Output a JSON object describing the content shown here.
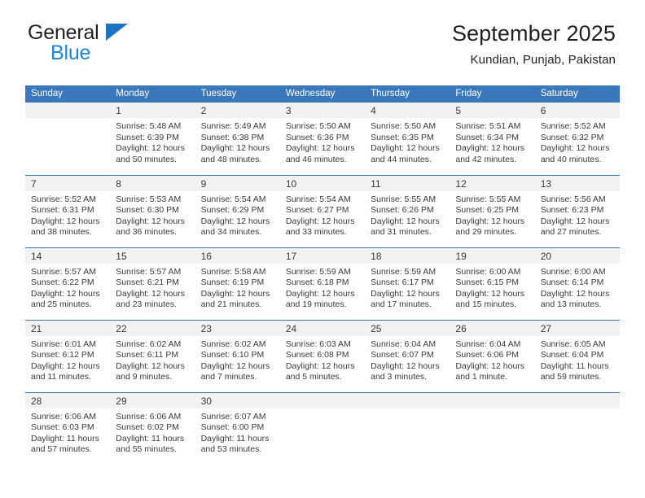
{
  "brand": {
    "line1": "General",
    "line2": "Blue",
    "triangle_color": "#1f72bd",
    "line2_color": "#1f84d6"
  },
  "header": {
    "title": "September 2025",
    "subtitle": "Kundian, Punjab, Pakistan"
  },
  "theme": {
    "header_bar": "#3b77bb",
    "daynum_band": "#f2f2f2",
    "text": "#3a3a3a"
  },
  "labels": {
    "sunrise_prefix": "Sunrise:",
    "sunset_prefix": "Sunset:",
    "daylight_prefix": "Daylight:"
  },
  "weekday_headers": [
    "Sunday",
    "Monday",
    "Tuesday",
    "Wednesday",
    "Thursday",
    "Friday",
    "Saturday"
  ],
  "weeks": [
    [
      {
        "day": "",
        "blank": true
      },
      {
        "day": "1",
        "sunrise": "Sunrise: 5:48 AM",
        "sunset": "Sunset: 6:39 PM",
        "daylight1": "Daylight: 12 hours",
        "daylight2": "and 50 minutes."
      },
      {
        "day": "2",
        "sunrise": "Sunrise: 5:49 AM",
        "sunset": "Sunset: 6:38 PM",
        "daylight1": "Daylight: 12 hours",
        "daylight2": "and 48 minutes."
      },
      {
        "day": "3",
        "sunrise": "Sunrise: 5:50 AM",
        "sunset": "Sunset: 6:36 PM",
        "daylight1": "Daylight: 12 hours",
        "daylight2": "and 46 minutes."
      },
      {
        "day": "4",
        "sunrise": "Sunrise: 5:50 AM",
        "sunset": "Sunset: 6:35 PM",
        "daylight1": "Daylight: 12 hours",
        "daylight2": "and 44 minutes."
      },
      {
        "day": "5",
        "sunrise": "Sunrise: 5:51 AM",
        "sunset": "Sunset: 6:34 PM",
        "daylight1": "Daylight: 12 hours",
        "daylight2": "and 42 minutes."
      },
      {
        "day": "6",
        "sunrise": "Sunrise: 5:52 AM",
        "sunset": "Sunset: 6:32 PM",
        "daylight1": "Daylight: 12 hours",
        "daylight2": "and 40 minutes."
      }
    ],
    [
      {
        "day": "7",
        "sunrise": "Sunrise: 5:52 AM",
        "sunset": "Sunset: 6:31 PM",
        "daylight1": "Daylight: 12 hours",
        "daylight2": "and 38 minutes."
      },
      {
        "day": "8",
        "sunrise": "Sunrise: 5:53 AM",
        "sunset": "Sunset: 6:30 PM",
        "daylight1": "Daylight: 12 hours",
        "daylight2": "and 36 minutes."
      },
      {
        "day": "9",
        "sunrise": "Sunrise: 5:54 AM",
        "sunset": "Sunset: 6:29 PM",
        "daylight1": "Daylight: 12 hours",
        "daylight2": "and 34 minutes."
      },
      {
        "day": "10",
        "sunrise": "Sunrise: 5:54 AM",
        "sunset": "Sunset: 6:27 PM",
        "daylight1": "Daylight: 12 hours",
        "daylight2": "and 33 minutes."
      },
      {
        "day": "11",
        "sunrise": "Sunrise: 5:55 AM",
        "sunset": "Sunset: 6:26 PM",
        "daylight1": "Daylight: 12 hours",
        "daylight2": "and 31 minutes."
      },
      {
        "day": "12",
        "sunrise": "Sunrise: 5:55 AM",
        "sunset": "Sunset: 6:25 PM",
        "daylight1": "Daylight: 12 hours",
        "daylight2": "and 29 minutes."
      },
      {
        "day": "13",
        "sunrise": "Sunrise: 5:56 AM",
        "sunset": "Sunset: 6:23 PM",
        "daylight1": "Daylight: 12 hours",
        "daylight2": "and 27 minutes."
      }
    ],
    [
      {
        "day": "14",
        "sunrise": "Sunrise: 5:57 AM",
        "sunset": "Sunset: 6:22 PM",
        "daylight1": "Daylight: 12 hours",
        "daylight2": "and 25 minutes."
      },
      {
        "day": "15",
        "sunrise": "Sunrise: 5:57 AM",
        "sunset": "Sunset: 6:21 PM",
        "daylight1": "Daylight: 12 hours",
        "daylight2": "and 23 minutes."
      },
      {
        "day": "16",
        "sunrise": "Sunrise: 5:58 AM",
        "sunset": "Sunset: 6:19 PM",
        "daylight1": "Daylight: 12 hours",
        "daylight2": "and 21 minutes."
      },
      {
        "day": "17",
        "sunrise": "Sunrise: 5:59 AM",
        "sunset": "Sunset: 6:18 PM",
        "daylight1": "Daylight: 12 hours",
        "daylight2": "and 19 minutes."
      },
      {
        "day": "18",
        "sunrise": "Sunrise: 5:59 AM",
        "sunset": "Sunset: 6:17 PM",
        "daylight1": "Daylight: 12 hours",
        "daylight2": "and 17 minutes."
      },
      {
        "day": "19",
        "sunrise": "Sunrise: 6:00 AM",
        "sunset": "Sunset: 6:15 PM",
        "daylight1": "Daylight: 12 hours",
        "daylight2": "and 15 minutes."
      },
      {
        "day": "20",
        "sunrise": "Sunrise: 6:00 AM",
        "sunset": "Sunset: 6:14 PM",
        "daylight1": "Daylight: 12 hours",
        "daylight2": "and 13 minutes."
      }
    ],
    [
      {
        "day": "21",
        "sunrise": "Sunrise: 6:01 AM",
        "sunset": "Sunset: 6:12 PM",
        "daylight1": "Daylight: 12 hours",
        "daylight2": "and 11 minutes."
      },
      {
        "day": "22",
        "sunrise": "Sunrise: 6:02 AM",
        "sunset": "Sunset: 6:11 PM",
        "daylight1": "Daylight: 12 hours",
        "daylight2": "and 9 minutes."
      },
      {
        "day": "23",
        "sunrise": "Sunrise: 6:02 AM",
        "sunset": "Sunset: 6:10 PM",
        "daylight1": "Daylight: 12 hours",
        "daylight2": "and 7 minutes."
      },
      {
        "day": "24",
        "sunrise": "Sunrise: 6:03 AM",
        "sunset": "Sunset: 6:08 PM",
        "daylight1": "Daylight: 12 hours",
        "daylight2": "and 5 minutes."
      },
      {
        "day": "25",
        "sunrise": "Sunrise: 6:04 AM",
        "sunset": "Sunset: 6:07 PM",
        "daylight1": "Daylight: 12 hours",
        "daylight2": "and 3 minutes."
      },
      {
        "day": "26",
        "sunrise": "Sunrise: 6:04 AM",
        "sunset": "Sunset: 6:06 PM",
        "daylight1": "Daylight: 12 hours",
        "daylight2": "and 1 minute."
      },
      {
        "day": "27",
        "sunrise": "Sunrise: 6:05 AM",
        "sunset": "Sunset: 6:04 PM",
        "daylight1": "Daylight: 11 hours",
        "daylight2": "and 59 minutes."
      }
    ],
    [
      {
        "day": "28",
        "sunrise": "Sunrise: 6:06 AM",
        "sunset": "Sunset: 6:03 PM",
        "daylight1": "Daylight: 11 hours",
        "daylight2": "and 57 minutes."
      },
      {
        "day": "29",
        "sunrise": "Sunrise: 6:06 AM",
        "sunset": "Sunset: 6:02 PM",
        "daylight1": "Daylight: 11 hours",
        "daylight2": "and 55 minutes."
      },
      {
        "day": "30",
        "sunrise": "Sunrise: 6:07 AM",
        "sunset": "Sunset: 6:00 PM",
        "daylight1": "Daylight: 11 hours",
        "daylight2": "and 53 minutes."
      },
      {
        "day": "",
        "blank": true
      },
      {
        "day": "",
        "blank": true
      },
      {
        "day": "",
        "blank": true
      },
      {
        "day": "",
        "blank": true
      }
    ]
  ]
}
